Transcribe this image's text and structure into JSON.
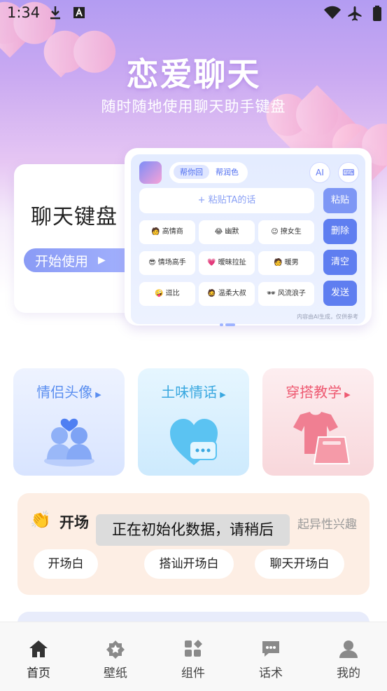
{
  "status_bar": {
    "time": "1:34"
  },
  "hero": {
    "title": "恋爱聊天",
    "subtitle": "随时随地使用聊天助手键盘"
  },
  "keyboard_card": {
    "title": "聊天键盘",
    "start_label": "开始使用",
    "tabs": [
      "帮你回",
      "帮润色"
    ],
    "paste_placeholder": "+ 粘贴TA的话",
    "side_buttons": [
      "粘贴",
      "删除",
      "清空",
      "发送"
    ],
    "chips": [
      {
        "label": "高情商",
        "icon": "🧑"
      },
      {
        "label": "幽默",
        "icon": "😂"
      },
      {
        "label": "撩女生",
        "icon": "😉"
      },
      {
        "label": "情场高手",
        "icon": "😎"
      },
      {
        "label": "暧昧拉扯",
        "icon": "💗"
      },
      {
        "label": "暖男",
        "icon": "🧑"
      },
      {
        "label": "逗比",
        "icon": "🤪"
      },
      {
        "label": "温柔大叔",
        "icon": "🧔"
      },
      {
        "label": "风流浪子",
        "icon": "🕶"
      }
    ],
    "disclaimer": "内容由AI生成，仅供参考"
  },
  "features": [
    {
      "label": "情侣头像",
      "color": "#5a8ef0",
      "bg": "#e3edff"
    },
    {
      "label": "土味情话",
      "color": "#3aa8e0",
      "bg": "#dff3ff"
    },
    {
      "label": "穿搭教学",
      "color": "#ee5a72",
      "bg": "#fde5e8"
    }
  ],
  "opening": {
    "title": "开场",
    "tail": "起异性兴趣",
    "pills": [
      "开场白",
      "搭讪开场白",
      "聊天开场白"
    ]
  },
  "toast": "正在初始化数据，请稍后",
  "tabbar": [
    {
      "label": "首页",
      "icon": "home-icon"
    },
    {
      "label": "壁纸",
      "icon": "star-badge-icon"
    },
    {
      "label": "组件",
      "icon": "grid-icon"
    },
    {
      "label": "话术",
      "icon": "chat-icon"
    },
    {
      "label": "我的",
      "icon": "person-icon"
    }
  ],
  "colors": {
    "accent": "#7f93f5",
    "tab_active": "#333333",
    "tab_inactive": "#8a8a8a"
  }
}
